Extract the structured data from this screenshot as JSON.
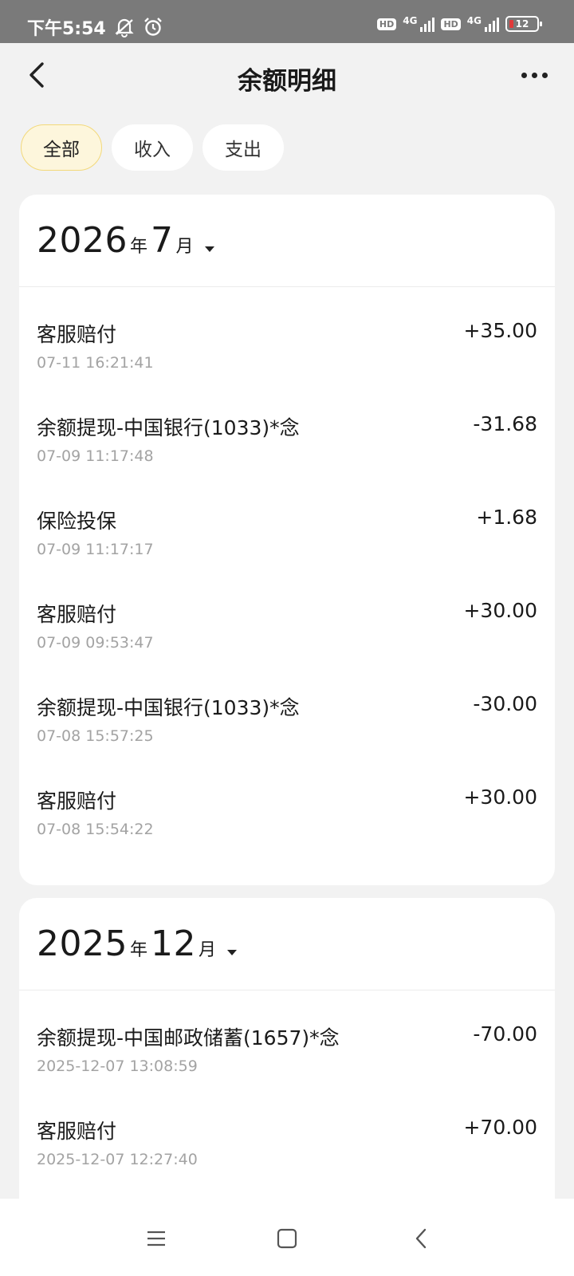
{
  "status_bar": {
    "time": "下午5:54",
    "hd1": "HD",
    "net1": "4G",
    "hd2": "HD",
    "net2": "4G",
    "battery": "12",
    "icons": [
      "mute-icon",
      "alarm-icon",
      "signal-icon",
      "battery-icon"
    ]
  },
  "header": {
    "title": "余额明细"
  },
  "filters": [
    {
      "label": "全部",
      "active": true
    },
    {
      "label": "收入",
      "active": false
    },
    {
      "label": "支出",
      "active": false
    }
  ],
  "groups": [
    {
      "year": "2026",
      "year_unit": "年",
      "month": "7",
      "month_unit": "月",
      "items": [
        {
          "name": "客服赔付",
          "time": "07-11 16:21:41",
          "amount": "+35.00"
        },
        {
          "name": "余额提现-中国银行(1033)*念",
          "time": "07-09 11:17:48",
          "amount": "-31.68"
        },
        {
          "name": "保险投保",
          "time": "07-09 11:17:17",
          "amount": "+1.68"
        },
        {
          "name": "客服赔付",
          "time": "07-09 09:53:47",
          "amount": "+30.00"
        },
        {
          "name": "余额提现-中国银行(1033)*念",
          "time": "07-08 15:57:25",
          "amount": "-30.00"
        },
        {
          "name": "客服赔付",
          "time": "07-08 15:54:22",
          "amount": "+30.00"
        }
      ]
    },
    {
      "year": "2025",
      "year_unit": "年",
      "month": "12",
      "month_unit": "月",
      "items": [
        {
          "name": "余额提现-中国邮政储蓄(1657)*念",
          "time": "2025-12-07 13:08:59",
          "amount": "-70.00"
        },
        {
          "name": "客服赔付",
          "time": "2025-12-07 12:27:40",
          "amount": "+70.00"
        }
      ]
    }
  ],
  "colors": {
    "active_chip_bg": "#fdf6dc",
    "active_chip_border": "#f3d97a",
    "timestamp": "#a3a3a3"
  }
}
